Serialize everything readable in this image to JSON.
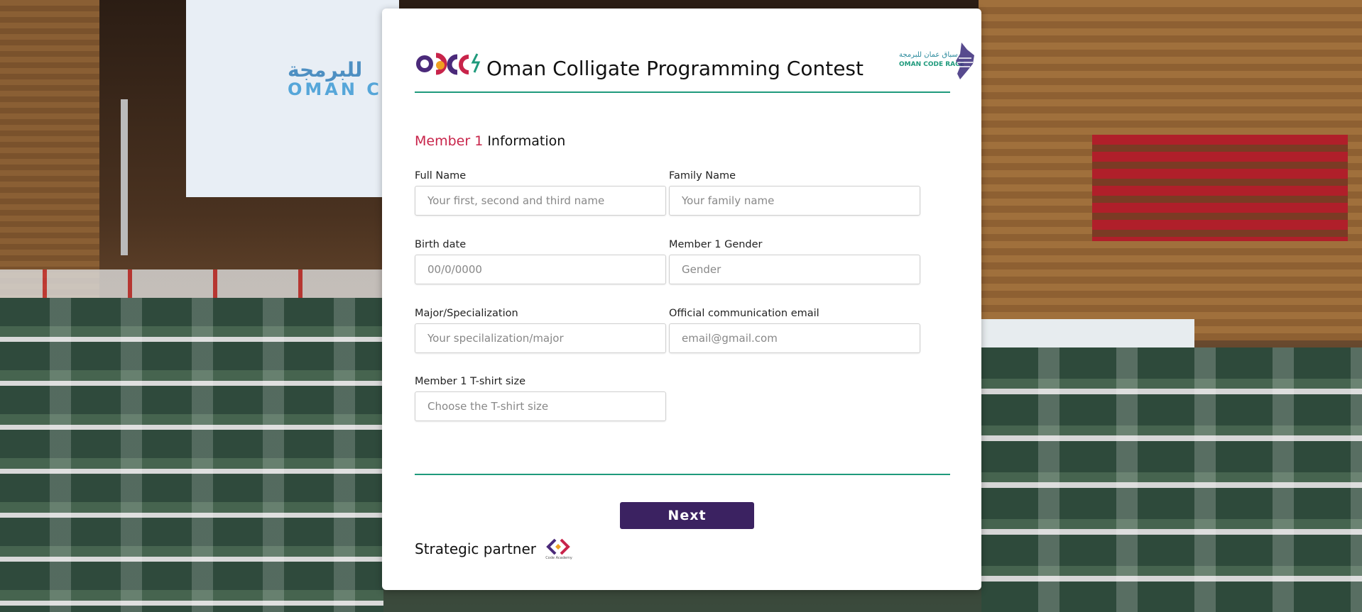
{
  "header": {
    "title": "Oman Colligate Programming Contest",
    "logo_left_name": "occ-logo",
    "logo_right": {
      "arabic": "سباق عمان للبرمجة",
      "english": "OMAN CODE RACE"
    }
  },
  "background": {
    "screen_arabic": "للبرمجة",
    "screen_english": "OMAN C"
  },
  "section": {
    "accent": "Member 1",
    "rest": " Information"
  },
  "form": {
    "full_name": {
      "label": "Full Name",
      "placeholder": "Your first, second and third name"
    },
    "family_name": {
      "label": "Family Name",
      "placeholder": "Your family name"
    },
    "birth_date": {
      "label": "Birth date",
      "placeholder": "00/0/0000"
    },
    "gender": {
      "label": "Member 1 Gender",
      "placeholder": "Gender"
    },
    "major": {
      "label": "Major/Specialization",
      "placeholder": "Your specilalization/major"
    },
    "email": {
      "label": "Official communication email",
      "placeholder": "email@gmail.com"
    },
    "tshirt": {
      "label": "Member 1 T-shirt size",
      "placeholder": "Choose the T-shirt size"
    }
  },
  "actions": {
    "next_label": "Next"
  },
  "footer": {
    "partner_label": "Strategic partner",
    "partner_logo_caption": "Code Academy"
  },
  "colors": {
    "accent": "#c8244a",
    "teal": "#1f9a7c",
    "button": "#3b2261"
  }
}
